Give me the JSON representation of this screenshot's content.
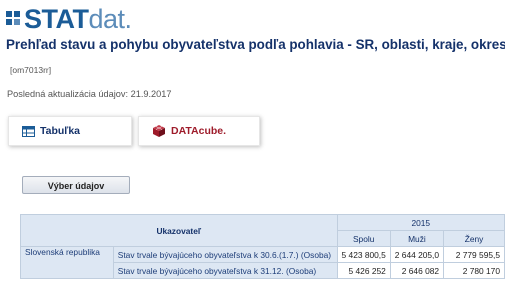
{
  "logo": {
    "bold": "STAT",
    "light": "dat."
  },
  "title": "Prehľad stavu a pohybu obyvateľstva podľa pohlavia - SR, oblasti, kraje, okresy,",
  "code": "[om7013rr]",
  "updated": "Posledná aktualizácia údajov: 21.9.2017",
  "tabs": {
    "table": "Tabuľka",
    "cube": "DATAcube."
  },
  "select_button": "Výber údajov",
  "colors": {
    "brand": "#1b5c97",
    "title": "#15326a",
    "cube": "#9e1b2a",
    "header_bg": "#dde7f3"
  },
  "table": {
    "indicator_header": "Ukazovateľ",
    "year": "2015",
    "columns": [
      "Spolu",
      "Muži",
      "Ženy"
    ],
    "region": "Slovenská republika",
    "rows": [
      {
        "label": "Stav trvale bývajúceho obyvateľstva k 30.6.(1.7.) (Osoba)",
        "values": [
          "5 423 800,5",
          "2 644 205,0",
          "2 779 595,5"
        ]
      },
      {
        "label": "Stav trvale bývajúceho obyvateľstva k 31.12. (Osoba)",
        "values": [
          "5 426 252",
          "2 646 082",
          "2 780 170"
        ]
      }
    ]
  }
}
